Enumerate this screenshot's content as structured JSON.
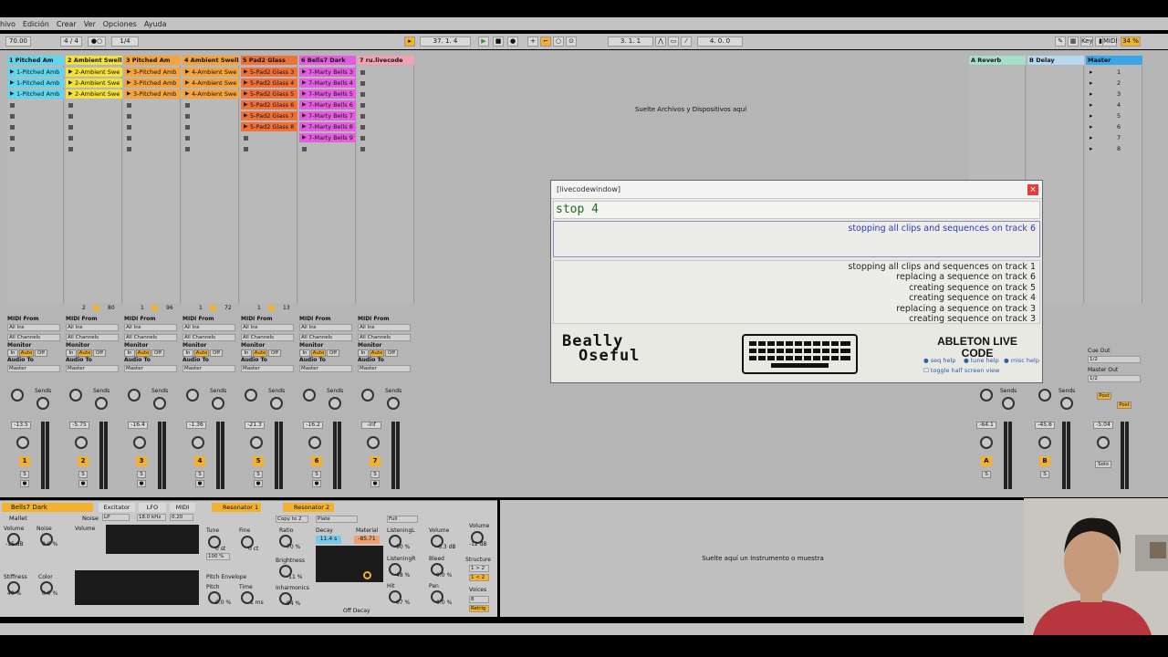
{
  "menu": [
    "hivo",
    "Edición",
    "Crear",
    "Ver",
    "Opciones",
    "Ayuda"
  ],
  "transport": {
    "tempo": "70.00",
    "signature": "4 / 4",
    "quantize": "1/4",
    "position": "37.  1.  4",
    "loop_start": "3.  1.  1",
    "loop_length": "4.  0.  0",
    "key_label": "Key",
    "midi_label": "MIDI",
    "cpu": "34 %"
  },
  "tracks": [
    {
      "name": "1 Pitched Am",
      "color": "#5fd6ef",
      "clips": [
        "1-Pitched Amb",
        "1-Pitched Amb",
        "1-Pitched Amb"
      ],
      "volume": "-13.5",
      "number": "1"
    },
    {
      "name": "2 Ambient Swells",
      "color": "#f4e23a",
      "clips": [
        "2-Ambient Swe",
        "2-Ambient Swe",
        "2-Ambient Swe"
      ],
      "volume": "-5.75",
      "number": "2"
    },
    {
      "name": "3 Pitched Am",
      "color": "#f5a33a",
      "clips": [
        "3-Pitched Amb",
        "3-Pitched Amb",
        "3-Pitched Amb"
      ],
      "volume": "-16.4",
      "number": "3"
    },
    {
      "name": "4 Ambient Swells",
      "color": "#f5a33a",
      "clips": [
        "4-Ambient Swe",
        "4-Ambient Swe",
        "4-Ambient Swe"
      ],
      "volume": "-1.36",
      "number": "4"
    },
    {
      "name": "5 Pad2 Glass",
      "color": "#f0703a",
      "clips": [
        "5-Pad2 Glass 3",
        "5-Pad2 Glass 4",
        "5-Pad2 Glass 5",
        "5-Pad2 Glass 6",
        "5-Pad2 Glass 7",
        "5-Pad2 Glass 8"
      ],
      "volume": "-21.3",
      "number": "5"
    },
    {
      "name": "6 Bells7 Dark",
      "color": "#e45de0",
      "clips": [
        "7-Marty Bells 3",
        "7-Marty Bells 4",
        "7-Marty Bells 5",
        "7-Marty Bells 6",
        "7-Marty Bells 7",
        "7-Marty Bells 8",
        "7-Marty Bells 9"
      ],
      "volume": "-16.2",
      "number": "6"
    },
    {
      "name": "7 ru.livecode",
      "color": "#f3a2b4",
      "clips": [],
      "volume": "-inf",
      "number": "7"
    }
  ],
  "track_stats": [
    {
      "a": "2",
      "b": "80"
    },
    {
      "a": "1",
      "b": "96"
    },
    {
      "a": "1",
      "b": "72"
    },
    {
      "a": "1",
      "b": "13"
    }
  ],
  "io_labels": {
    "midi_from": "MIDI From",
    "all_ins": "All Ins",
    "all_channels": "All Channels",
    "monitor": "Monitor",
    "in": "In",
    "auto": "Auto",
    "off": "Off",
    "audio_to": "Audio To",
    "master": "Master",
    "sends": "Sends"
  },
  "drop_text": "Suelte Archivos y Dispositivos aquí",
  "returns": [
    {
      "name": "A Reverb",
      "color": "#a6dfc8",
      "volume": "-64.1",
      "letter": "A"
    },
    {
      "name": "B Delay",
      "color": "#b6d8f0",
      "volume": "-45.6",
      "letter": "B"
    }
  ],
  "master": {
    "name": "Master",
    "color": "#3aa6e8",
    "scenes": [
      "1",
      "2",
      "3",
      "4",
      "5",
      "6",
      "7",
      "8"
    ],
    "volume": "-5.04",
    "cue_out": "Cue Out",
    "cue_value": "1/2",
    "master_out": "Master Out",
    "master_value": "1/2",
    "post": "Post",
    "solo": "Solo"
  },
  "livecode": {
    "title": "[livecodewindow]",
    "close": "×",
    "input": "stop 4",
    "result": "stopping all clips and sequences on track 6",
    "log": [
      "stopping all clips and sequences on track 1",
      "replacing a sequence on track 6",
      "creating sequence on track 5",
      "creating sequence on track 4",
      "replacing a sequence on track 3",
      "creating sequence on track 3"
    ],
    "logo_line1": "Beally",
    "logo_line2": "Oseful",
    "brand_line1": "ABLETON LIVE",
    "brand_line2": "CODE",
    "help": [
      "seq help",
      "tune help",
      "misc help"
    ],
    "toggle": "toggle half screen view"
  },
  "device": {
    "track_name": "Bells7 Dark",
    "tabs": [
      "Excitator",
      "LFO",
      "MIDI"
    ],
    "resonators": [
      "Resonator 1",
      "Resonator 2"
    ],
    "mallet": "Mallet",
    "noise": "Noise",
    "filter_type": "LP",
    "freq": "18.0 kHz",
    "freq_val": "0.20",
    "volume_label": "Volume",
    "noise_label": "Noise",
    "stiffness": "Stiffness",
    "color": "Color",
    "vol_db": "-15 dB",
    "noise_pct": "0.0 %",
    "stiff_pct": "40 %",
    "color_pct": "0.0 %",
    "copy": "Copy to 2",
    "plate": "Plate",
    "full": "Full",
    "decay_label": "Decay",
    "decay_val": "11.4 s",
    "material_label": "Material",
    "material_val": "-85.71",
    "ratio": "Ratio",
    "ratio_val": "70 %",
    "brightness": "Brightness",
    "brightness_val": "-11 %",
    "inharmonics": "Inharmonics",
    "inharm_val": "94 %",
    "tune": "Tune",
    "fine": "Fine",
    "tune_val": "0 st",
    "fine_val": "0 ct",
    "key_pct": "100 %",
    "pitch_env": "Pitch Envelope",
    "pitch": "Pitch",
    "time": "Time",
    "pitch_val": "0.0 %",
    "time_val": "1 ms",
    "listening_l": "ListeningL",
    "listening_r": "ListeningR",
    "ll_val": "90 %",
    "lr_val": "48 %",
    "hit": "Hit",
    "hit_val": "67 %",
    "volume2": "Volume",
    "vol2_val": "-6.3 dB",
    "bleed": "Bleed",
    "bleed_val": "0.0 %",
    "pan": "Pan",
    "pan_val": "0.0 %",
    "out_volume": "Volume",
    "out_vol_val": "-12 dB",
    "structure": "Structure",
    "struct_a": "1 > 2",
    "struct_b": "1 < 2",
    "voices": "Voices",
    "voices_val": "8",
    "retrig": "Retrig",
    "off_decay": "Off Decay",
    "drop_instrument": "Suelte aquí un Instrumento o muestra"
  }
}
